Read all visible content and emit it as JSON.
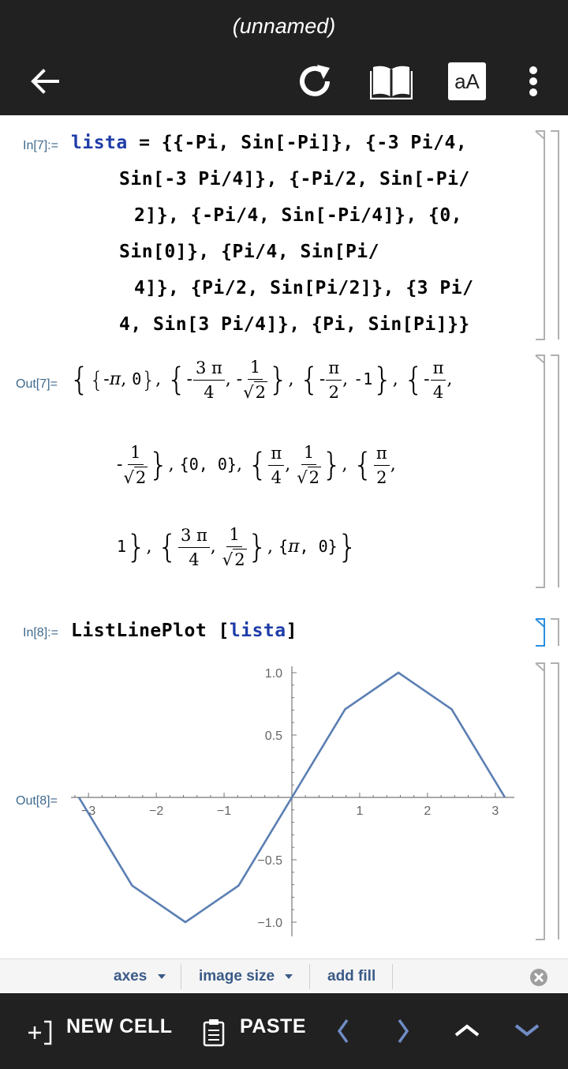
{
  "app": {
    "title": "(unnamed)",
    "font_size_button": "aA"
  },
  "cells": {
    "in7": {
      "label": "In[7]:=",
      "kw": "lista",
      "line1": " = {{-Pi, Sin[-Pi]}, {-3 Pi/4,",
      "line2": "Sin[-3 Pi/4]}, {-Pi/2, Sin[-Pi/",
      "line3": "2]}, {-Pi/4, Sin[-Pi/4]}, {0,",
      "line4": "Sin[0]}, {Pi/4, Sin[Pi/",
      "line5": "4]}, {Pi/2, Sin[Pi/2]}, {3 Pi/",
      "line6": "4, Sin[3 Pi/4]}, {Pi, Sin[Pi]}}"
    },
    "out7": {
      "label": "Out[7]=",
      "pi": "π",
      "three_pi": "3 π",
      "one": "1",
      "two": "2",
      "four": "4",
      "zero": "0",
      "neg_one": "-1",
      "minus": "-",
      "comma": ",",
      "sqrt_sign": "√"
    },
    "in8": {
      "label": "In[8]:=",
      "fn": "ListLinePlot",
      "open": "[",
      "arg": "lista",
      "close": "]"
    },
    "out8": {
      "label": "Out[8]="
    }
  },
  "chart_data": {
    "type": "line",
    "title": "",
    "xlabel": "",
    "ylabel": "",
    "xlim": [
      -3.14159,
      3.14159
    ],
    "ylim": [
      -1.0,
      1.0
    ],
    "x_ticks": [
      -3,
      -2,
      -1,
      1,
      2,
      3
    ],
    "y_ticks": [
      -1.0,
      -0.5,
      0.5,
      1.0
    ],
    "x_tick_labels": [
      "−3",
      "−2",
      "−1",
      "1",
      "2",
      "3"
    ],
    "y_tick_labels": [
      "−1.0",
      "−0.5",
      "0.5",
      "1.0"
    ],
    "series": [
      {
        "x": [
          -3.14159,
          -2.35619,
          -1.5708,
          -0.785398,
          0,
          0.785398,
          1.5708,
          2.35619,
          3.14159
        ],
        "y": [
          0,
          -0.707107,
          -1,
          -0.707107,
          0,
          0.707107,
          1,
          0.707107,
          0
        ]
      }
    ],
    "color": "#5b7fb3",
    "grid": false
  },
  "suggestions": {
    "axes": "axes",
    "image_size": "image size",
    "add_fill": "add fill"
  },
  "bottom_bar": {
    "new_cell": "NEW CELL",
    "paste": "PASTE"
  },
  "colors": {
    "bar_bg": "#212121",
    "keyword_blue": "#1e3ca8",
    "label_blue": "#3f6a8f",
    "plot_line": "#5b7fb3"
  }
}
